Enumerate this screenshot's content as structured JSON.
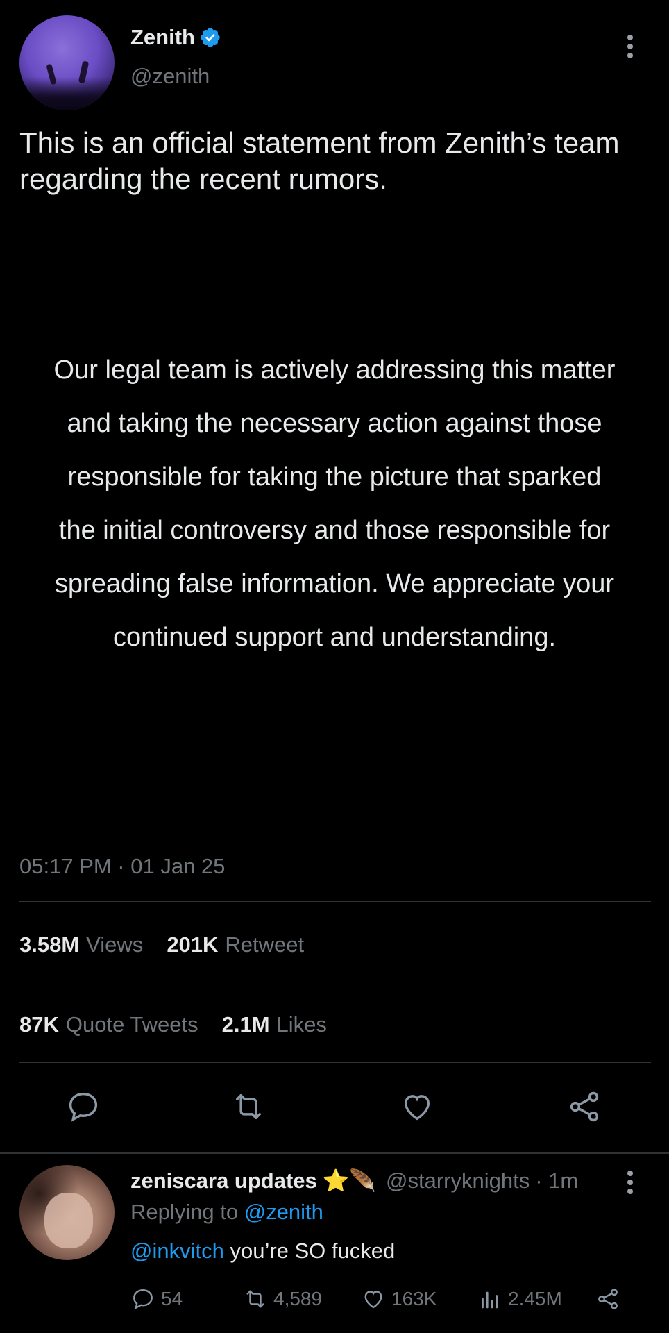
{
  "tweet": {
    "author_name": "Zenith",
    "author_handle": "@zenith",
    "text": "This is an official statement from Zenith’s team regarding the recent rumors.",
    "statement": "Our legal team is actively addressing this matter and taking the necessary action against those responsible for taking the picture that sparked the initial controversy and those responsible for spreading false information. We appreciate your continued support and understanding.",
    "timestamp": "05:17 PM · 01 Jan 25",
    "stats": {
      "views_value": "3.58M",
      "views_label": "Views",
      "retweets_value": "201K",
      "retweets_label": "Retweet",
      "quotes_value": "87K",
      "quotes_label": "Quote Tweets",
      "likes_value": "2.1M",
      "likes_label": "Likes"
    }
  },
  "reply": {
    "author_name": "zeniscara updates",
    "emoji": "⭐🪶",
    "author_handle": "@starryknights",
    "time": "· 1m",
    "replying_prefix": "Replying to",
    "replying_to": "@zenith",
    "mention": "@inkvitch",
    "text": " you’re SO fucked",
    "counts": {
      "replies": "54",
      "retweets": "4,589",
      "likes": "163K",
      "views": "2.45M"
    }
  },
  "colors": {
    "background": "#000000",
    "text": "#e7e9ea",
    "muted": "#71767b",
    "link": "#1d9bf0",
    "verified": "#1d9bf0",
    "divider": "#2f3336"
  }
}
